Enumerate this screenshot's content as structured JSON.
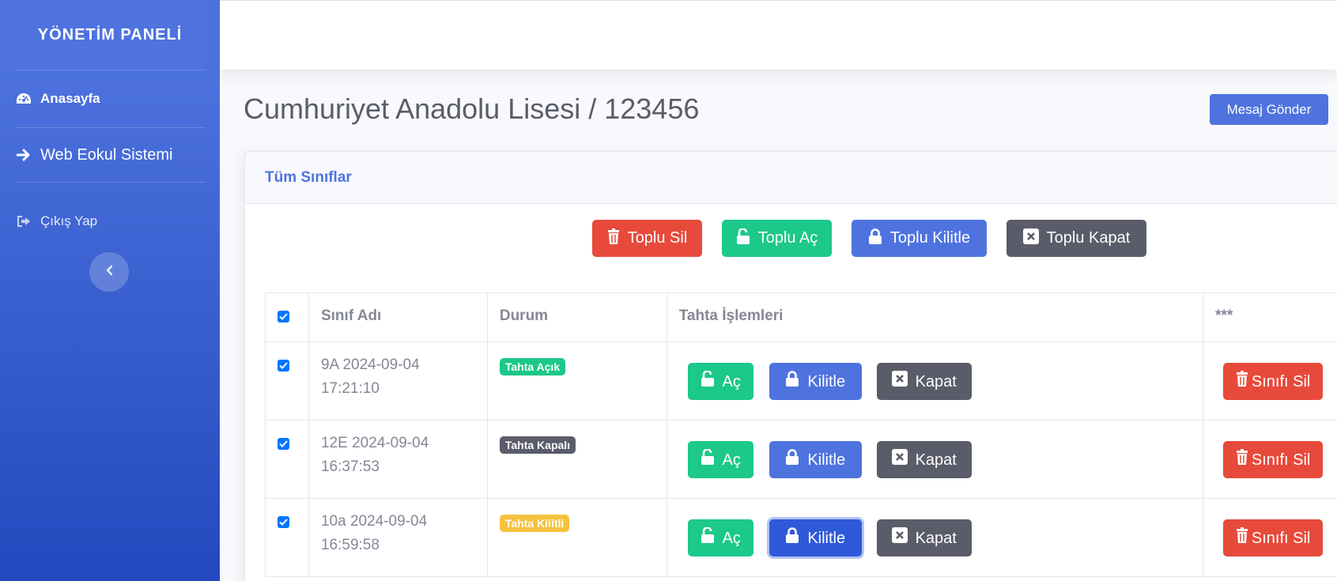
{
  "sidebar": {
    "brand": "YÖNETİM PANELİ",
    "items": [
      {
        "label": "Anasayfa",
        "icon": "tachometer-icon"
      },
      {
        "label": "Web Eokul Sistemi",
        "icon": "arrow-right-icon"
      },
      {
        "label": "Çıkış Yap",
        "icon": "sign-out-icon"
      }
    ],
    "toggle_icon": "chevron-left-icon"
  },
  "page": {
    "title": "Cumhuriyet Anadolu Lisesi / 123456",
    "message_button": "Mesaj Gönder"
  },
  "card": {
    "header": "Tüm Sınıflar",
    "bulk": {
      "delete": "Toplu Sil",
      "open": "Toplu Aç",
      "lock": "Toplu Kilitle",
      "close": "Toplu Kapat"
    }
  },
  "table": {
    "headers": [
      "Sınıf Adı",
      "Durum",
      "Tahta İşlemleri",
      "***"
    ],
    "actions": {
      "open": "Aç",
      "lock": "Kilitle",
      "close": "Kapat",
      "delete": "Sınıfı Sil"
    },
    "rows": [
      {
        "name_line1": "9A 2024-09-04",
        "name_line2": "17:21:10",
        "status": "Tahta Açık"
      },
      {
        "name_line1": "12E 2024-09-04",
        "name_line2": "16:37:53",
        "status": "Tahta Kapalı"
      },
      {
        "name_line1": "10a 2024-09-04",
        "name_line2": "16:59:58",
        "status": "Tahta Kilitli"
      }
    ]
  },
  "colors": {
    "primary": "#4e73df",
    "success": "#1cc88a",
    "danger": "#e74a3b",
    "dark": "#5a5c69",
    "warning": "#f6c23e"
  }
}
